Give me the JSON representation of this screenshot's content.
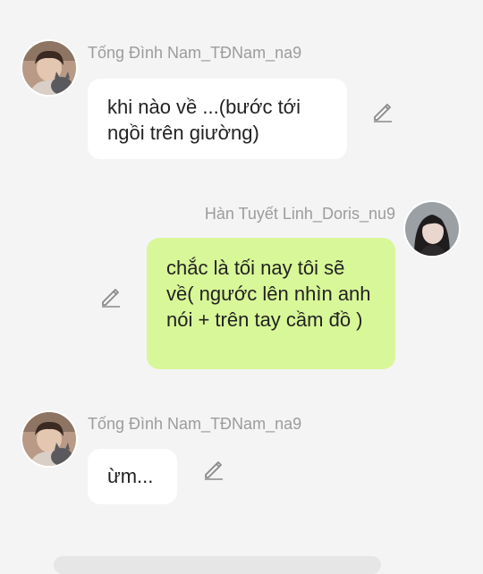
{
  "messages": [
    {
      "side": "left",
      "sender": "Tống Đình Nam_TĐNam_na9",
      "text": "khi nào về ...(bước tới ngồi trên giường)",
      "avatar_icon": "avatar-young-man-with-cat-icon"
    },
    {
      "side": "right",
      "sender": "Hàn Tuyết Linh_Doris_nu9",
      "text": "chắc là tối nay tôi sẽ về( ngước lên nhìn anh nói + trên tay cầm đồ )",
      "avatar_icon": "avatar-young-woman-icon"
    },
    {
      "side": "left",
      "sender": "Tống Đình Nam_TĐNam_na9",
      "text": "ừm...",
      "avatar_icon": "avatar-young-man-with-cat-icon"
    }
  ],
  "colors": {
    "background": "#f4f4f4",
    "bubble_left": "#ffffff",
    "bubble_right": "#d8f798",
    "sender_name": "#9c9c9c",
    "edit_icon": "#8a8a8a"
  },
  "icons": {
    "edit": "pencil-edit-icon"
  }
}
